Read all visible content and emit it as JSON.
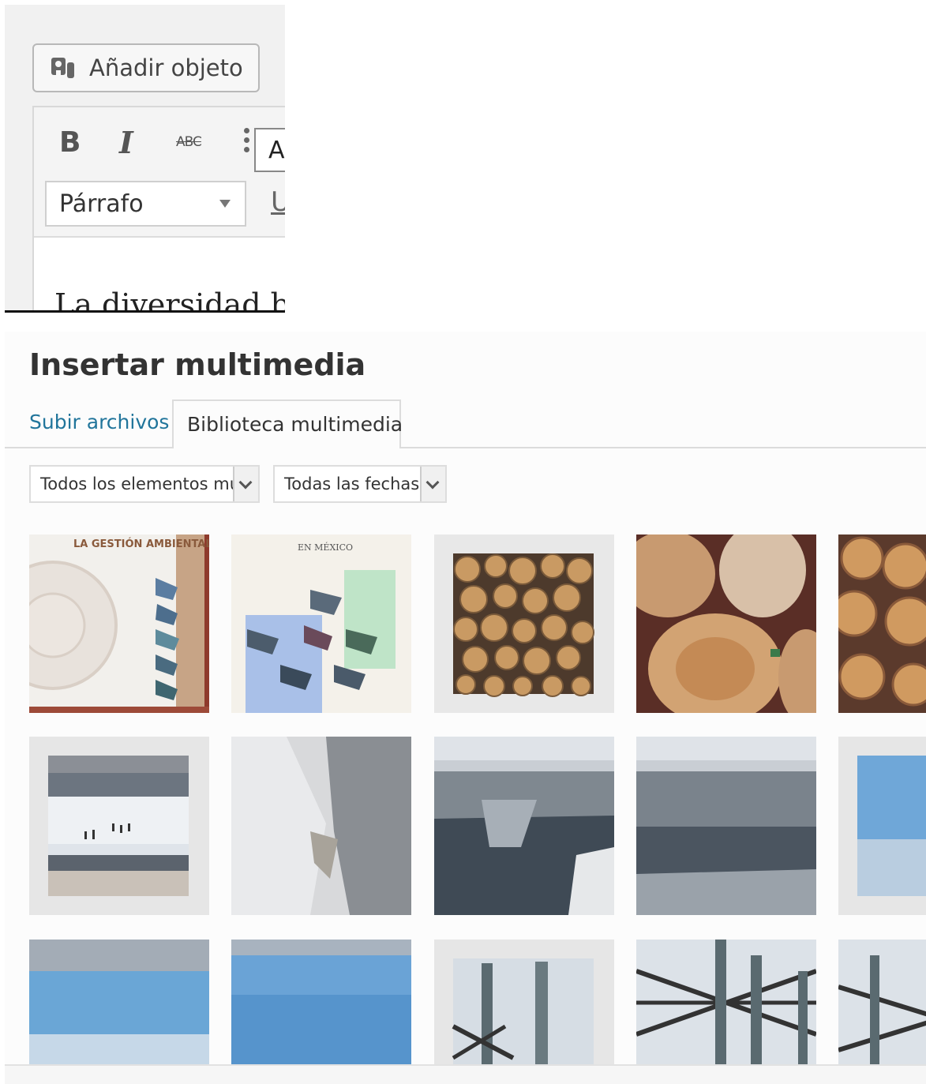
{
  "editor": {
    "add_media_label": "Añadir objeto",
    "toolbar": {
      "bold": "B",
      "italic": "I",
      "strikethrough": "ABC",
      "font_value": "Ar",
      "format_value": "Párrafo",
      "underline": "U"
    },
    "content_preview": "La diversidad bio"
  },
  "media_modal": {
    "title": "Insertar multimedia",
    "tabs": [
      {
        "label": "Subir archivos",
        "active": false
      },
      {
        "label": "Biblioteca multimedia",
        "active": true
      }
    ],
    "filters": {
      "type_selected": "Todos los elementos multimedia",
      "date_selected": "Todas las fechas"
    },
    "thumb_cover_1_text": "LA GESTIÓN AMBIENTAL EN MÉXICO",
    "thumb_cover_2_text": "EN MÉXICO",
    "colors": {
      "link": "#21759b",
      "modal_bg": "#fcfcfc"
    }
  }
}
